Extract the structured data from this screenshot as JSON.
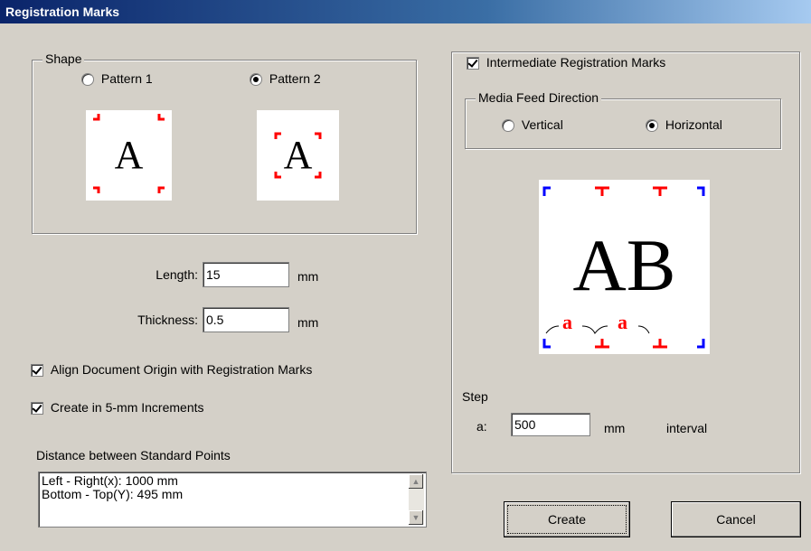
{
  "title": "Registration Marks",
  "shape": {
    "legend": "Shape",
    "pattern1_label": "Pattern 1",
    "pattern2_label": "Pattern 2",
    "selected": "Pattern 2",
    "preview_letter": "A"
  },
  "length": {
    "label": "Length:",
    "value": "15",
    "unit": "mm"
  },
  "thickness": {
    "label": "Thickness:",
    "value": "0.5",
    "unit": "mm"
  },
  "align_origin": {
    "label": "Align Document Origin with Registration Marks",
    "checked": true
  },
  "increments": {
    "label": "Create in 5-mm Increments",
    "checked": true
  },
  "distance": {
    "label": "Distance between Standard Points",
    "lines": [
      "Left - Right(x): 1000 mm",
      "Bottom - Top(Y): 495 mm"
    ]
  },
  "intermediate": {
    "label": "Intermediate Registration Marks",
    "checked": true,
    "media_feed": {
      "legend": "Media Feed Direction",
      "vertical_label": "Vertical",
      "horizontal_label": "Horizontal",
      "selected": "Horizontal"
    },
    "preview_text": "AB",
    "preview_marker": "a",
    "step": {
      "label": "Step",
      "param_label": "a:",
      "value": "500",
      "unit": "mm",
      "suffix": "interval"
    }
  },
  "buttons": {
    "create": "Create",
    "cancel": "Cancel"
  },
  "colors": {
    "mark_red": "#ff0000",
    "mark_blue": "#0000ff",
    "title_bar": "#0a246a"
  }
}
